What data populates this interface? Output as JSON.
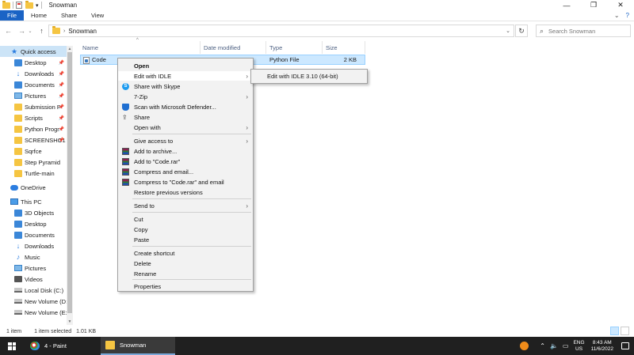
{
  "window": {
    "title": "Snowman",
    "controls": [
      "—",
      "❐",
      "✕"
    ]
  },
  "ribbon": {
    "tabs": [
      "File",
      "Home",
      "Share",
      "View"
    ],
    "expand_glyph": "⌄",
    "help_glyph": "?"
  },
  "address": {
    "path": "Snowman",
    "search_placeholder": "Search Snowman"
  },
  "nav": {
    "quick_access": "Quick access",
    "quick_items": [
      {
        "label": "Desktop",
        "icon": "desktop-icon",
        "pinned": true
      },
      {
        "label": "Downloads",
        "icon": "downloads-icon",
        "pinned": true
      },
      {
        "label": "Documents",
        "icon": "documents-icon",
        "pinned": true
      },
      {
        "label": "Pictures",
        "icon": "pictures-icon",
        "pinned": true
      },
      {
        "label": "Submission P",
        "icon": "folder-icon",
        "pinned": true
      },
      {
        "label": "Scripts",
        "icon": "folder-icon",
        "pinned": true
      },
      {
        "label": "Python Progr",
        "icon": "folder-icon",
        "pinned": true
      },
      {
        "label": "SCREENSHO1",
        "icon": "folder-icon",
        "pinned": true
      },
      {
        "label": "Sqrfce",
        "icon": "folder-icon",
        "pinned": false
      },
      {
        "label": "Step Pyramid",
        "icon": "folder-icon",
        "pinned": false
      },
      {
        "label": "Turtle-main",
        "icon": "folder-icon",
        "pinned": false
      }
    ],
    "onedrive": "OneDrive",
    "this_pc": "This PC",
    "pc_items": [
      {
        "label": "3D Objects",
        "icon": "3d-objects-icon"
      },
      {
        "label": "Desktop",
        "icon": "desktop-icon"
      },
      {
        "label": "Documents",
        "icon": "documents-icon"
      },
      {
        "label": "Downloads",
        "icon": "downloads-icon"
      },
      {
        "label": "Music",
        "icon": "music-icon"
      },
      {
        "label": "Pictures",
        "icon": "pictures-icon"
      },
      {
        "label": "Videos",
        "icon": "videos-icon"
      },
      {
        "label": "Local Disk (C:)",
        "icon": "drive-icon"
      },
      {
        "label": "New Volume (D:",
        "icon": "drive-icon"
      },
      {
        "label": "New Volume (E:)",
        "icon": "drive-icon"
      }
    ]
  },
  "columns": [
    "Name",
    "Date modified",
    "Type",
    "Size"
  ],
  "file": {
    "name": "Code",
    "type": "Python File",
    "size": "2 KB"
  },
  "context_menu": {
    "open": "Open",
    "edit_idle": "Edit with IDLE",
    "skype": "Share with Skype",
    "zip": "7-Zip",
    "defender": "Scan with Microsoft Defender...",
    "share": "Share",
    "open_with": "Open with",
    "give_access": "Give access to",
    "add_archive": "Add to archive...",
    "add_rar": "Add to \"Code.rar\"",
    "compress_email": "Compress and email...",
    "compress_rar_email": "Compress to \"Code.rar\" and email",
    "restore": "Restore previous versions",
    "send_to": "Send to",
    "cut": "Cut",
    "copy": "Copy",
    "paste": "Paste",
    "create_shortcut": "Create shortcut",
    "delete": "Delete",
    "rename": "Rename",
    "properties": "Properties"
  },
  "submenu": {
    "item": "Edit with IDLE 3.10 (64-bit)"
  },
  "status": {
    "items": "1 item",
    "selected": "1 item selected",
    "size": "1.01 KB"
  },
  "taskbar": {
    "paint": "4 - Paint",
    "explorer": "Snowman",
    "lang1": "ENG",
    "lang2": "US",
    "time": "8:43 AM",
    "date": "11/6/2022"
  },
  "colors": {
    "accent": "#1a63c5",
    "selection": "#cce8ff",
    "taskbar": "#202020"
  }
}
